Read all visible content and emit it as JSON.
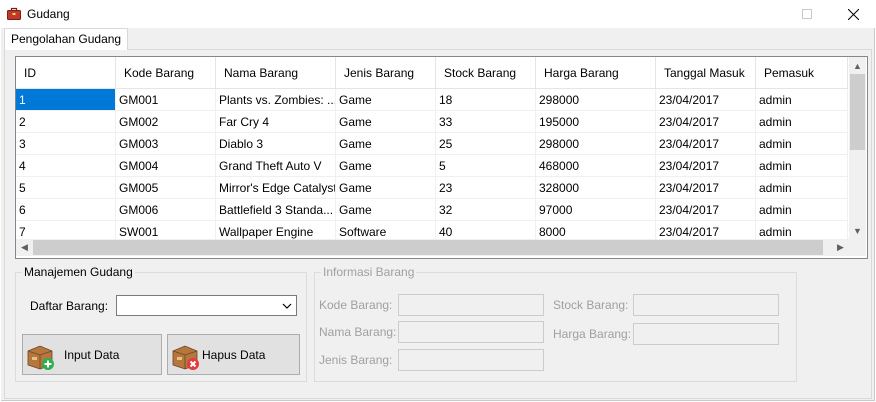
{
  "window": {
    "title": "Gudang",
    "tab_label": "Pengolahan Gudang"
  },
  "grid": {
    "columns": [
      "ID",
      "Kode Barang",
      "Nama Barang",
      "Jenis Barang",
      "Stock Barang",
      "Harga Barang",
      "Tanggal Masuk",
      "Pemasuk"
    ],
    "rows": [
      [
        "1",
        "GM001",
        "Plants vs. Zombies: ...",
        "Game",
        "18",
        "298000",
        "23/04/2017",
        "admin"
      ],
      [
        "2",
        "GM002",
        "Far Cry 4",
        "Game",
        "33",
        "195000",
        "23/04/2017",
        "admin"
      ],
      [
        "3",
        "GM003",
        "Diablo 3",
        "Game",
        "25",
        "298000",
        "23/04/2017",
        "admin"
      ],
      [
        "4",
        "GM004",
        "Grand Theft Auto V",
        "Game",
        "5",
        "468000",
        "23/04/2017",
        "admin"
      ],
      [
        "5",
        "GM005",
        "Mirror's Edge Catalyst",
        "Game",
        "23",
        "328000",
        "23/04/2017",
        "admin"
      ],
      [
        "6",
        "GM006",
        "Battlefield 3 Standa...",
        "Game",
        "32",
        "97000",
        "23/04/2017",
        "admin"
      ],
      [
        "7",
        "SW001",
        "Wallpaper Engine",
        "Software",
        "40",
        "8000",
        "23/04/2017",
        "admin"
      ]
    ],
    "selected_row": 0
  },
  "manajemen": {
    "title": "Manajemen Gudang",
    "daftar_label": "Daftar Barang:",
    "daftar_value": "",
    "input_button": "Input Data",
    "hapus_button": "Hapus Data"
  },
  "informasi": {
    "title": "Informasi Barang",
    "kode_label": "Kode Barang:",
    "nama_label": "Nama Barang:",
    "jenis_label": "Jenis Barang:",
    "stock_label": "Stock Barang:",
    "harga_label": "Harga Barang:"
  },
  "colors": {
    "selection": "#0078d7",
    "button_face": "#e1e1e1",
    "window_bg": "#f0f0f0"
  },
  "icons": {
    "app": "toolbox-icon",
    "input": "box-add-icon",
    "hapus": "box-remove-icon"
  }
}
